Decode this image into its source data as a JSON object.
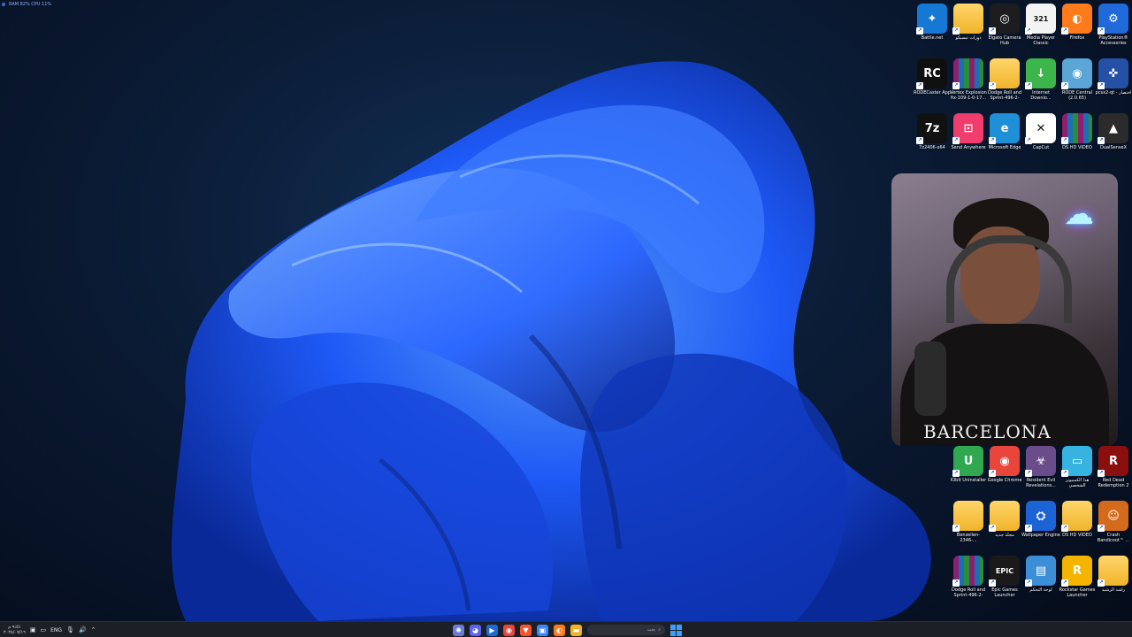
{
  "overlay": {
    "perf_text": "RAM 82%  CPU 11%"
  },
  "desktop_icons": [
    {
      "id": "battlenet",
      "label": "Battle.net",
      "icon": "battlenet-icon",
      "color": "#1478d4",
      "glyph": "✦"
    },
    {
      "id": "folder-ar",
      "label": "دورات تبسيكو",
      "icon": "folder-icon",
      "color": "#f0b429",
      "glyph": ""
    },
    {
      "id": "elgato",
      "label": "Elgato Camera Hub",
      "icon": "camera-icon",
      "color": "#1d1d1f",
      "glyph": "◎"
    },
    {
      "id": "mpc",
      "label": "Media Player Classic",
      "icon": "mpc-icon",
      "color": "#f3f3f3",
      "glyph": "321"
    },
    {
      "id": "firefox",
      "label": "Firefox",
      "icon": "firefox-icon",
      "color": "#ff7a1a",
      "glyph": "◐"
    },
    {
      "id": "ps-acc",
      "label": "PlayStation® Accessories",
      "icon": "gamepad-icon",
      "color": "#1f6ad8",
      "glyph": "⚙"
    },
    {
      "id": "rodecaster",
      "label": "RODECaster App",
      "icon": "rode-icon",
      "color": "#0f0f0f",
      "glyph": "RC"
    },
    {
      "id": "vertex",
      "label": "Vertex Explosion fix-109-1-0-17...",
      "icon": "winrar-icon",
      "color": "#8e1f6e",
      "glyph": ""
    },
    {
      "id": "dodge1",
      "label": "Dodge Roll and Sprint-496-2-30...",
      "icon": "folder-icon",
      "color": "#f0b429",
      "glyph": ""
    },
    {
      "id": "idm",
      "label": "Internet Downlo...",
      "icon": "idm-icon",
      "color": "#3cb54a",
      "glyph": "↓"
    },
    {
      "id": "rodecentral",
      "label": "RODE Central (2.0.65)",
      "icon": "rode-central-icon",
      "color": "#5aa6d6",
      "glyph": "◉"
    },
    {
      "id": "pcsx2",
      "label": "pcsx2-qt - اختصار",
      "icon": "pcsx2-icon",
      "color": "#2451a6",
      "glyph": "✜"
    },
    {
      "id": "7z",
      "label": "7z2406-x64",
      "icon": "7zip-icon",
      "color": "#111111",
      "glyph": "7z"
    },
    {
      "id": "sendanywhere",
      "label": "Send Anywhere",
      "icon": "send-anywhere-icon",
      "color": "#ef3d6d",
      "glyph": "⊡"
    },
    {
      "id": "edge",
      "label": "Microsoft Edge",
      "icon": "edge-icon",
      "color": "#1f8fd8",
      "glyph": "e"
    },
    {
      "id": "capcut",
      "label": "CapCut",
      "icon": "capcut-icon",
      "color": "#ffffff",
      "glyph": "✕"
    },
    {
      "id": "dshd1",
      "label": "DS HD VIDEO",
      "icon": "winrar-icon",
      "color": "#8e1f6e",
      "glyph": ""
    },
    {
      "id": "dualsense",
      "label": "DualSenseX",
      "icon": "dualsense-icon",
      "color": "#2b2b2b",
      "glyph": "▲"
    },
    {
      "id": "iobit",
      "label": "IObit Uninstaller",
      "icon": "iobit-icon",
      "color": "#2fa84f",
      "glyph": "U"
    },
    {
      "id": "chrome",
      "label": "Google Chrome",
      "icon": "chrome-icon",
      "color": "#e8453c",
      "glyph": "◉"
    },
    {
      "id": "re-rev",
      "label": "Resident Evil Revelations...",
      "icon": "resident-evil-icon",
      "color": "#6b4c8a",
      "glyph": "☣"
    },
    {
      "id": "thispc",
      "label": "هذا الكمبيوتر الشخصي",
      "icon": "monitor-icon",
      "color": "#36b3e0",
      "glyph": "▭"
    },
    {
      "id": "rdr2",
      "label": "Red Dead Redemption 2",
      "icon": "rdr2-icon",
      "color": "#8b0f0f",
      "glyph": "R"
    },
    {
      "id": "benseilen",
      "label": "Benseilen-2346-...",
      "icon": "folder-icon",
      "color": "#f0b429",
      "glyph": ""
    },
    {
      "id": "newfolder",
      "label": "مجلد جديد",
      "icon": "folder-icon",
      "color": "#f0b429",
      "glyph": ""
    },
    {
      "id": "wallpaper",
      "label": "Wallpaper Engine",
      "icon": "wallpaper-engine-icon",
      "color": "#1c64d6",
      "glyph": "⛭"
    },
    {
      "id": "dshd2",
      "label": "DS HD VIDEO",
      "icon": "folder-icon",
      "color": "#f0b429",
      "glyph": ""
    },
    {
      "id": "crash",
      "label": "Crash Bandicoot™ ...",
      "icon": "crash-icon",
      "color": "#d46a1c",
      "glyph": "☺"
    },
    {
      "id": "dodge2",
      "label": "Dodge Roll and Sprint-496-2-30...",
      "icon": "winrar-icon",
      "color": "#8e1f6e",
      "glyph": ""
    },
    {
      "id": "epic",
      "label": "Epic Games Launcher",
      "icon": "epic-games-icon",
      "color": "#1a1a1a",
      "glyph": "EPIC"
    },
    {
      "id": "control",
      "label": "لوحة التحكم",
      "icon": "control-panel-icon",
      "color": "#3c8fd6",
      "glyph": "▤"
    },
    {
      "id": "rockstar",
      "label": "Rockstar Games Launcher",
      "icon": "rockstar-icon",
      "color": "#f4b400",
      "glyph": "R"
    },
    {
      "id": "rashid",
      "label": "راشد الرشيد",
      "icon": "folder-user-icon",
      "color": "#f0b429",
      "glyph": ""
    }
  ],
  "webcam": {
    "shirt_text": "BARCELONA"
  },
  "taskbar": {
    "clock_time": "٩:٥١ م",
    "clock_date": "٢٠٢٤/٠٧/١٦",
    "language": "ENG",
    "search_placeholder": "بحث",
    "apps": [
      {
        "id": "copilot",
        "icon": "copilot-icon",
        "color": "#6b7bd8"
      },
      {
        "id": "discord",
        "icon": "discord-icon",
        "color": "#5865f2"
      },
      {
        "id": "media",
        "icon": "media-player-icon",
        "color": "#1f6ad8"
      },
      {
        "id": "chrome",
        "icon": "chrome-icon",
        "color": "#e8453c"
      },
      {
        "id": "brave",
        "icon": "brave-icon",
        "color": "#fb542b"
      },
      {
        "id": "store",
        "icon": "store-icon",
        "color": "#3a86ff"
      },
      {
        "id": "firefox",
        "icon": "firefox-icon",
        "color": "#ff7a1a"
      },
      {
        "id": "explorer",
        "icon": "file-explorer-icon",
        "color": "#f0b429"
      }
    ]
  }
}
